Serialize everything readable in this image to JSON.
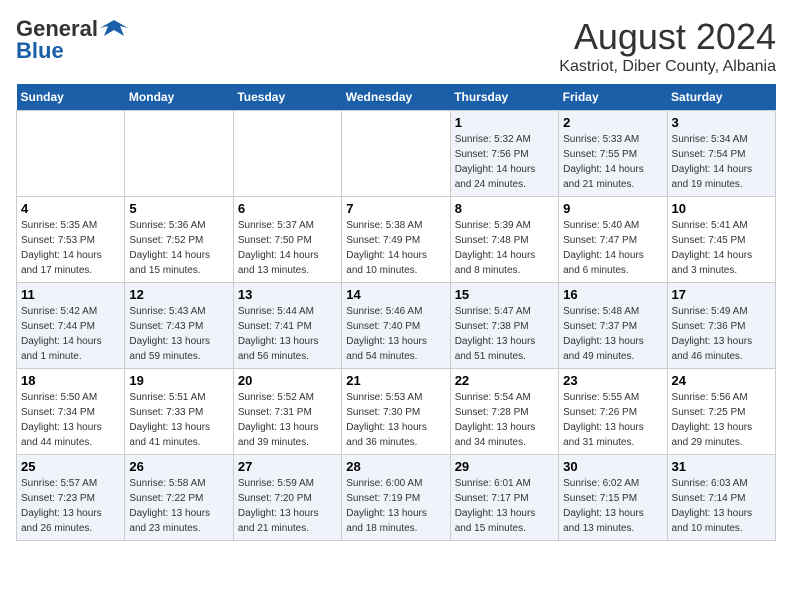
{
  "header": {
    "logo_general": "General",
    "logo_blue": "Blue",
    "main_title": "August 2024",
    "subtitle": "Kastriot, Diber County, Albania"
  },
  "days_of_week": [
    "Sunday",
    "Monday",
    "Tuesday",
    "Wednesday",
    "Thursday",
    "Friday",
    "Saturday"
  ],
  "weeks": [
    [
      {
        "num": "",
        "sunrise": "",
        "sunset": "",
        "daylight": "",
        "empty": true
      },
      {
        "num": "",
        "sunrise": "",
        "sunset": "",
        "daylight": "",
        "empty": true
      },
      {
        "num": "",
        "sunrise": "",
        "sunset": "",
        "daylight": "",
        "empty": true
      },
      {
        "num": "",
        "sunrise": "",
        "sunset": "",
        "daylight": "",
        "empty": true
      },
      {
        "num": "1",
        "sunrise": "Sunrise: 5:32 AM",
        "sunset": "Sunset: 7:56 PM",
        "daylight": "Daylight: 14 hours and 24 minutes."
      },
      {
        "num": "2",
        "sunrise": "Sunrise: 5:33 AM",
        "sunset": "Sunset: 7:55 PM",
        "daylight": "Daylight: 14 hours and 21 minutes."
      },
      {
        "num": "3",
        "sunrise": "Sunrise: 5:34 AM",
        "sunset": "Sunset: 7:54 PM",
        "daylight": "Daylight: 14 hours and 19 minutes."
      }
    ],
    [
      {
        "num": "4",
        "sunrise": "Sunrise: 5:35 AM",
        "sunset": "Sunset: 7:53 PM",
        "daylight": "Daylight: 14 hours and 17 minutes."
      },
      {
        "num": "5",
        "sunrise": "Sunrise: 5:36 AM",
        "sunset": "Sunset: 7:52 PM",
        "daylight": "Daylight: 14 hours and 15 minutes."
      },
      {
        "num": "6",
        "sunrise": "Sunrise: 5:37 AM",
        "sunset": "Sunset: 7:50 PM",
        "daylight": "Daylight: 14 hours and 13 minutes."
      },
      {
        "num": "7",
        "sunrise": "Sunrise: 5:38 AM",
        "sunset": "Sunset: 7:49 PM",
        "daylight": "Daylight: 14 hours and 10 minutes."
      },
      {
        "num": "8",
        "sunrise": "Sunrise: 5:39 AM",
        "sunset": "Sunset: 7:48 PM",
        "daylight": "Daylight: 14 hours and 8 minutes."
      },
      {
        "num": "9",
        "sunrise": "Sunrise: 5:40 AM",
        "sunset": "Sunset: 7:47 PM",
        "daylight": "Daylight: 14 hours and 6 minutes."
      },
      {
        "num": "10",
        "sunrise": "Sunrise: 5:41 AM",
        "sunset": "Sunset: 7:45 PM",
        "daylight": "Daylight: 14 hours and 3 minutes."
      }
    ],
    [
      {
        "num": "11",
        "sunrise": "Sunrise: 5:42 AM",
        "sunset": "Sunset: 7:44 PM",
        "daylight": "Daylight: 14 hours and 1 minute."
      },
      {
        "num": "12",
        "sunrise": "Sunrise: 5:43 AM",
        "sunset": "Sunset: 7:43 PM",
        "daylight": "Daylight: 13 hours and 59 minutes."
      },
      {
        "num": "13",
        "sunrise": "Sunrise: 5:44 AM",
        "sunset": "Sunset: 7:41 PM",
        "daylight": "Daylight: 13 hours and 56 minutes."
      },
      {
        "num": "14",
        "sunrise": "Sunrise: 5:46 AM",
        "sunset": "Sunset: 7:40 PM",
        "daylight": "Daylight: 13 hours and 54 minutes."
      },
      {
        "num": "15",
        "sunrise": "Sunrise: 5:47 AM",
        "sunset": "Sunset: 7:38 PM",
        "daylight": "Daylight: 13 hours and 51 minutes."
      },
      {
        "num": "16",
        "sunrise": "Sunrise: 5:48 AM",
        "sunset": "Sunset: 7:37 PM",
        "daylight": "Daylight: 13 hours and 49 minutes."
      },
      {
        "num": "17",
        "sunrise": "Sunrise: 5:49 AM",
        "sunset": "Sunset: 7:36 PM",
        "daylight": "Daylight: 13 hours and 46 minutes."
      }
    ],
    [
      {
        "num": "18",
        "sunrise": "Sunrise: 5:50 AM",
        "sunset": "Sunset: 7:34 PM",
        "daylight": "Daylight: 13 hours and 44 minutes."
      },
      {
        "num": "19",
        "sunrise": "Sunrise: 5:51 AM",
        "sunset": "Sunset: 7:33 PM",
        "daylight": "Daylight: 13 hours and 41 minutes."
      },
      {
        "num": "20",
        "sunrise": "Sunrise: 5:52 AM",
        "sunset": "Sunset: 7:31 PM",
        "daylight": "Daylight: 13 hours and 39 minutes."
      },
      {
        "num": "21",
        "sunrise": "Sunrise: 5:53 AM",
        "sunset": "Sunset: 7:30 PM",
        "daylight": "Daylight: 13 hours and 36 minutes."
      },
      {
        "num": "22",
        "sunrise": "Sunrise: 5:54 AM",
        "sunset": "Sunset: 7:28 PM",
        "daylight": "Daylight: 13 hours and 34 minutes."
      },
      {
        "num": "23",
        "sunrise": "Sunrise: 5:55 AM",
        "sunset": "Sunset: 7:26 PM",
        "daylight": "Daylight: 13 hours and 31 minutes."
      },
      {
        "num": "24",
        "sunrise": "Sunrise: 5:56 AM",
        "sunset": "Sunset: 7:25 PM",
        "daylight": "Daylight: 13 hours and 29 minutes."
      }
    ],
    [
      {
        "num": "25",
        "sunrise": "Sunrise: 5:57 AM",
        "sunset": "Sunset: 7:23 PM",
        "daylight": "Daylight: 13 hours and 26 minutes."
      },
      {
        "num": "26",
        "sunrise": "Sunrise: 5:58 AM",
        "sunset": "Sunset: 7:22 PM",
        "daylight": "Daylight: 13 hours and 23 minutes."
      },
      {
        "num": "27",
        "sunrise": "Sunrise: 5:59 AM",
        "sunset": "Sunset: 7:20 PM",
        "daylight": "Daylight: 13 hours and 21 minutes."
      },
      {
        "num": "28",
        "sunrise": "Sunrise: 6:00 AM",
        "sunset": "Sunset: 7:19 PM",
        "daylight": "Daylight: 13 hours and 18 minutes."
      },
      {
        "num": "29",
        "sunrise": "Sunrise: 6:01 AM",
        "sunset": "Sunset: 7:17 PM",
        "daylight": "Daylight: 13 hours and 15 minutes."
      },
      {
        "num": "30",
        "sunrise": "Sunrise: 6:02 AM",
        "sunset": "Sunset: 7:15 PM",
        "daylight": "Daylight: 13 hours and 13 minutes."
      },
      {
        "num": "31",
        "sunrise": "Sunrise: 6:03 AM",
        "sunset": "Sunset: 7:14 PM",
        "daylight": "Daylight: 13 hours and 10 minutes."
      }
    ]
  ]
}
